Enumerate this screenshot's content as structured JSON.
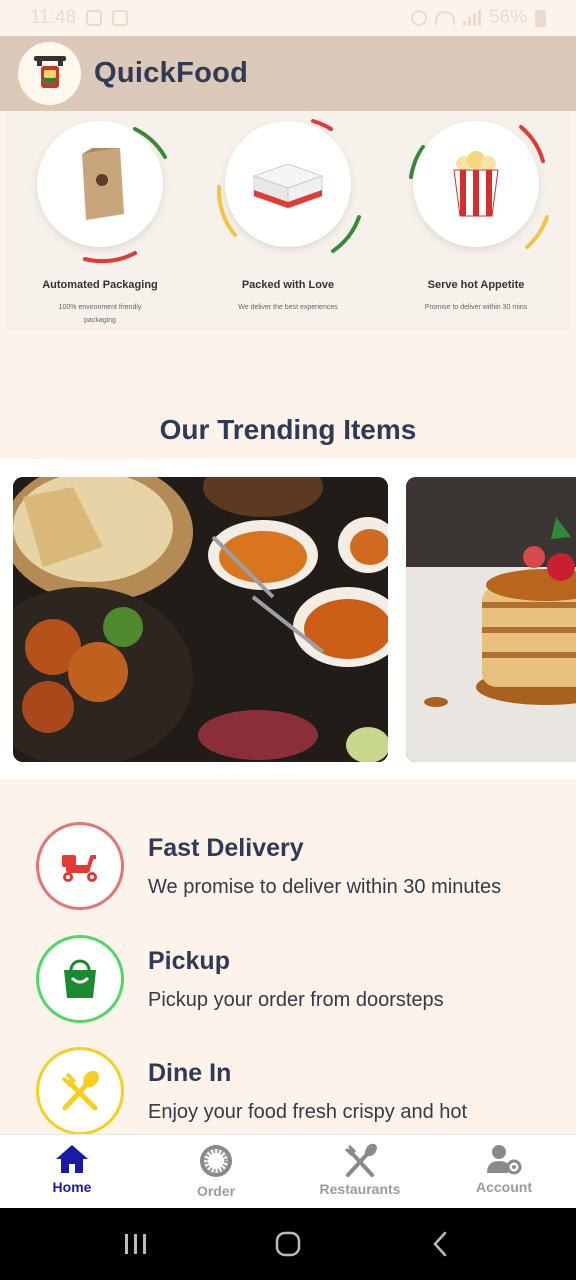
{
  "status_bar": {
    "time": "11:48",
    "battery": "56%"
  },
  "app": {
    "title": "QuickFood"
  },
  "features": [
    {
      "title": "Automated Packaging",
      "desc": "100% environment friendly packaging",
      "icon": "paper-bag-icon"
    },
    {
      "title": "Packed with Love",
      "desc": "We deliver the best experiences",
      "icon": "food-box-icon"
    },
    {
      "title": "Serve hot Appetite",
      "desc": "Promise to deliver within 30 mins",
      "icon": "popcorn-icon"
    }
  ],
  "trending": {
    "title": "Our Trending Items"
  },
  "services": [
    {
      "title": "Fast Delivery",
      "desc": "We promise to deliver within 30 minutes",
      "icon": "scooter-icon",
      "color": "#e57373"
    },
    {
      "title": "Pickup",
      "desc": "Pickup your order from doorsteps",
      "icon": "shopping-bag-icon",
      "color": "#4cd964"
    },
    {
      "title": "Dine In",
      "desc": "Enjoy your food fresh crispy and hot",
      "icon": "cutlery-icon",
      "color": "#f5d020"
    }
  ],
  "nav": [
    {
      "label": "Home",
      "icon": "home-icon",
      "active": true
    },
    {
      "label": "Order",
      "icon": "order-icon",
      "active": false
    },
    {
      "label": "Restaurants",
      "icon": "restaurant-icon",
      "active": false
    },
    {
      "label": "Account",
      "icon": "account-settings-icon",
      "active": false
    }
  ],
  "colors": {
    "appbar": "#dcc8b8",
    "background": "#fdf3ea",
    "title": "#2f3a54",
    "nav_active": "#1a1aa6",
    "nav_inactive": "#9b9b9b"
  }
}
